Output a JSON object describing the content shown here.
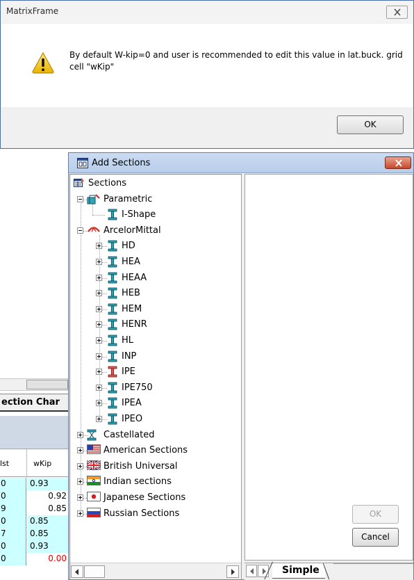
{
  "background_app": {
    "panel_title": "ection Char",
    "columns": {
      "lst": "lst",
      "wkip": "wKip"
    },
    "rows": [
      {
        "left": "0",
        "right": "0.93",
        "align": "left",
        "bg": "cyan",
        "color": "black"
      },
      {
        "left": "0",
        "right": "0.92",
        "align": "right",
        "bg": "white",
        "color": "black"
      },
      {
        "left": "9",
        "right": "0.85",
        "align": "right",
        "bg": "white",
        "color": "black"
      },
      {
        "left": "0",
        "right": "0.85",
        "align": "left",
        "bg": "cyan",
        "color": "black"
      },
      {
        "left": "7",
        "right": "0.85",
        "align": "left",
        "bg": "cyan",
        "color": "black"
      },
      {
        "left": "0",
        "right": "0.93",
        "align": "left",
        "bg": "cyan",
        "color": "black"
      },
      {
        "left": "0",
        "right": "0.00",
        "align": "right",
        "bg": "white",
        "color": "red"
      }
    ]
  },
  "message_box": {
    "title": "MatrixFrame",
    "text": "By default W-kip=0 and user is recommended to edit this value in lat.buck. grid cell  \"wKip\"",
    "ok_label": "OK",
    "icon": "warning-icon",
    "accent_color": "#4a6fa8"
  },
  "add_sections": {
    "title": "Add Sections",
    "tree": {
      "root": "Sections",
      "parametric": {
        "label": "Parametric",
        "children": [
          "I-Shape"
        ]
      },
      "arcelor": {
        "label": "ArcelorMittal",
        "children": [
          "HD",
          "HEA",
          "HEAA",
          "HEB",
          "HEM",
          "HENR",
          "HL",
          "INP",
          "IPE",
          "IPE750",
          "IPEA",
          "IPEO"
        ]
      },
      "castellated": "Castellated",
      "american": "American Sections",
      "british": "British Universal",
      "indian": "Indian sections",
      "japanese": "Japanese Sections",
      "russian": "Russian Sections"
    },
    "preview": {
      "ok_label": "OK",
      "cancel_label": "Cancel"
    },
    "tab_label": "Simple"
  }
}
